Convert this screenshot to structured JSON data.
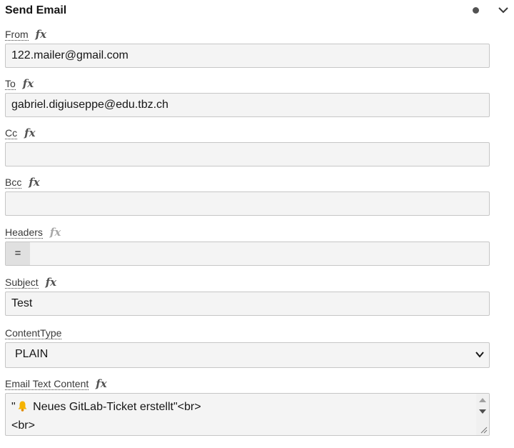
{
  "panel": {
    "title": "Send Email"
  },
  "fields": {
    "from": {
      "label": "From",
      "fx": "fx",
      "value": "122.mailer@gmail.com"
    },
    "to": {
      "label": "To",
      "fx": "fx",
      "value": "gabriel.digiuseppe@edu.tbz.ch"
    },
    "cc": {
      "label": "Cc",
      "fx": "fx",
      "value": ""
    },
    "bcc": {
      "label": "Bcc",
      "fx": "fx",
      "value": ""
    },
    "headers": {
      "label": "Headers",
      "fx": "fx",
      "separator": "="
    },
    "subject": {
      "label": "Subject",
      "fx": "fx",
      "value": "Test"
    },
    "content_type": {
      "label": "ContentType",
      "selected": "PLAIN"
    },
    "email_text": {
      "label": "Email Text Content",
      "fx": "fx",
      "line1_prefix": "\"",
      "line1_text": " Neues GitLab-Ticket erstellt\"<br>",
      "line2": "<br>"
    }
  },
  "icons": {
    "status": "dot-icon",
    "collapse": "chevron-down-icon",
    "expression": "fx-icon",
    "emoji": "bell-icon"
  },
  "colors": {
    "input_bg": "#f4f4f4",
    "border": "#c6c6c6",
    "bell": "#f5b301"
  }
}
